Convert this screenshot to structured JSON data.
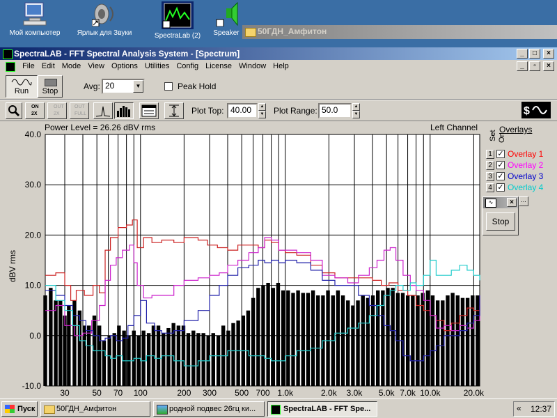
{
  "desktop": {
    "icons": [
      {
        "label": "Мой компьютер",
        "icon": "my-computer-icon"
      },
      {
        "label": "Ярлык для Звуки",
        "icon": "speaker-shortcut-icon"
      },
      {
        "label": "SpectraLab (2)",
        "icon": "spectralab-shortcut-icon"
      },
      {
        "label": "Speaker",
        "icon": "speaker-shortcut-icon"
      }
    ]
  },
  "background_window": {
    "title": "50ГДН_Амфитон"
  },
  "app": {
    "title": "SpectraLAB - FFT Spectral Analysis System - [Spectrum]",
    "menu": [
      "File",
      "Edit",
      "Mode",
      "View",
      "Options",
      "Utilities",
      "Config",
      "License",
      "Window",
      "Help"
    ],
    "run_label": "Run",
    "stop_label": "Stop",
    "avg_label": "Avg:",
    "avg_value": "20",
    "peak_hold_label": "Peak Hold",
    "peak_hold_checked": false,
    "plot_top_label": "Plot Top:",
    "plot_top_value": "40.00",
    "plot_range_label": "Plot Range:",
    "plot_range_value": "50.0",
    "zoom_buttons": [
      "ON 2X",
      "OUT 2X",
      "OUT FULL"
    ],
    "power_level": "Power Level = 26.26 dBV rms",
    "channel": "Left Channel"
  },
  "overlays": {
    "title": "Overlays",
    "set_label": "Set",
    "on_label": "On",
    "items": [
      {
        "num": "1",
        "name": "Overlay 1",
        "color": "#ff0000",
        "on": true
      },
      {
        "num": "2",
        "name": "Overlay 2",
        "color": "#ff00ff",
        "on": true
      },
      {
        "num": "3",
        "name": "Overlay 3",
        "color": "#0000cc",
        "on": true
      },
      {
        "num": "4",
        "name": "Overlay 4",
        "color": "#00cccc",
        "on": true
      }
    ],
    "mini_stop_label": "Stop"
  },
  "taskbar": {
    "start_label": "Пуск",
    "tasks": [
      "50ГДН_Амфитон",
      "родной подвес 26гц ки...",
      "SpectraLAB - FFT Spe..."
    ],
    "clock": "12:37",
    "tray_arrow": "«"
  },
  "chart_data": {
    "type": "bar",
    "ylabel": "dBV rms",
    "xscale": "log",
    "ylim": [
      -10,
      40
    ],
    "xlim": [
      22,
      22000
    ],
    "yticks": [
      "40.0",
      "30.0",
      "20.0",
      "10.0",
      "0.0",
      "-10.0"
    ],
    "ytick_values": [
      40,
      30,
      20,
      10,
      0,
      -10
    ],
    "xticks": [
      "30",
      "50",
      "70",
      "100",
      "200",
      "300",
      "500",
      "700",
      "1.0k",
      "2.0k",
      "3.0k",
      "5.0k",
      "7.0k",
      "10.0k",
      "20.0k"
    ],
    "xtick_values": [
      30,
      50,
      70,
      100,
      200,
      300,
      500,
      700,
      1000,
      2000,
      3000,
      5000,
      7000,
      10000,
      20000
    ],
    "grid": true,
    "bar_freqs": [
      22,
      24,
      26,
      28,
      30,
      32,
      35,
      38,
      41,
      44,
      48,
      52,
      56,
      61,
      66,
      71,
      77,
      83,
      90,
      97,
      105,
      114,
      123,
      133,
      144,
      156,
      169,
      183,
      198,
      214,
      232,
      251,
      272,
      294,
      318,
      345,
      373,
      404,
      437,
      473,
      512,
      554,
      600,
      650,
      703,
      761,
      824,
      892,
      966,
      1046,
      1132,
      1225,
      1326,
      1436,
      1554,
      1682,
      1821,
      1971,
      2134,
      2310,
      2501,
      2707,
      2930,
      3172,
      3434,
      3717,
      4024,
      4356,
      4715,
      5104,
      5525,
      5981,
      6475,
      7009,
      7587,
      8213,
      8891,
      9624,
      10418,
      11278,
      12209,
      13216,
      14306,
      15487,
      16765,
      18148,
      19645,
      21266
    ],
    "bar_values": [
      8,
      9.5,
      7,
      7,
      4,
      6,
      7,
      5,
      2,
      2,
      4,
      2,
      -1,
      0,
      0.5,
      2,
      1,
      0,
      1,
      0,
      1,
      0.5,
      2,
      2,
      0.5,
      1.5,
      2.5,
      2,
      2,
      0.5,
      1,
      0.5,
      0.5,
      0,
      0.5,
      0,
      2,
      1,
      2.5,
      3,
      4,
      5,
      7.5,
      9.5,
      10,
      10.5,
      9.5,
      10.5,
      9,
      9,
      8.5,
      9,
      8.5,
      8.5,
      9,
      8,
      8,
      9,
      8,
      9,
      8,
      7,
      6,
      7,
      8,
      7.5,
      8,
      9,
      9,
      9.5,
      9.5,
      8.5,
      8.5,
      8,
      8,
      8,
      8.5,
      9,
      8,
      7,
      7,
      8,
      8.5,
      8,
      7.5,
      7.5,
      8,
      8
    ],
    "series": [
      {
        "name": "Overlay 1",
        "color": "#cc2222",
        "points": [
          [
            22,
            12
          ],
          [
            26,
            12.5
          ],
          [
            30,
            10
          ],
          [
            33,
            7
          ],
          [
            36,
            9
          ],
          [
            41,
            8
          ],
          [
            47,
            10
          ],
          [
            52,
            8.5
          ],
          [
            57,
            17
          ],
          [
            62,
            19.5
          ],
          [
            70,
            21.5
          ],
          [
            80,
            22
          ],
          [
            88,
            23
          ],
          [
            95,
            17.5
          ],
          [
            105,
            19.5
          ],
          [
            120,
            18.5
          ],
          [
            140,
            19
          ],
          [
            170,
            18.5
          ],
          [
            200,
            19.5
          ],
          [
            250,
            19
          ],
          [
            290,
            18
          ],
          [
            340,
            17.5
          ],
          [
            400,
            17
          ],
          [
            470,
            18
          ],
          [
            560,
            18
          ],
          [
            650,
            17.5
          ],
          [
            720,
            19
          ],
          [
            800,
            18.5
          ],
          [
            900,
            17
          ],
          [
            1000,
            16.5
          ],
          [
            1200,
            16
          ],
          [
            1500,
            14
          ],
          [
            1800,
            12.5
          ],
          [
            2200,
            11.5
          ],
          [
            2700,
            11.5
          ],
          [
            3200,
            11.5
          ],
          [
            4000,
            11
          ],
          [
            4600,
            10
          ],
          [
            5200,
            10.5
          ],
          [
            6000,
            9
          ],
          [
            7000,
            8
          ],
          [
            8000,
            6
          ],
          [
            9000,
            5
          ],
          [
            10000,
            4
          ],
          [
            11000,
            3
          ],
          [
            12500,
            1
          ],
          [
            14000,
            2.5
          ],
          [
            16000,
            4
          ],
          [
            18000,
            5.5
          ],
          [
            20000,
            5
          ],
          [
            22000,
            8
          ]
        ]
      },
      {
        "name": "Overlay 2",
        "color": "#cc22cc",
        "points": [
          [
            22,
            5
          ],
          [
            26,
            6
          ],
          [
            30,
            2
          ],
          [
            35,
            0
          ],
          [
            40,
            0.5
          ],
          [
            46,
            3
          ],
          [
            52,
            6
          ],
          [
            57,
            11
          ],
          [
            62,
            14
          ],
          [
            68,
            15.5
          ],
          [
            75,
            17
          ],
          [
            84,
            18
          ],
          [
            90,
            14.5
          ],
          [
            95,
            10
          ],
          [
            105,
            7.5
          ],
          [
            120,
            8
          ],
          [
            140,
            8
          ],
          [
            170,
            10
          ],
          [
            200,
            11
          ],
          [
            250,
            11.5
          ],
          [
            300,
            12
          ],
          [
            350,
            12.5
          ],
          [
            400,
            14
          ],
          [
            470,
            15
          ],
          [
            560,
            16.5
          ],
          [
            650,
            17.5
          ],
          [
            720,
            19.5
          ],
          [
            800,
            19
          ],
          [
            900,
            17
          ],
          [
            1000,
            17
          ],
          [
            1200,
            16.5
          ],
          [
            1500,
            15
          ],
          [
            1800,
            12
          ],
          [
            2200,
            11.5
          ],
          [
            2700,
            10.5
          ],
          [
            3200,
            12
          ],
          [
            3800,
            13.5
          ],
          [
            4300,
            15
          ],
          [
            4800,
            17
          ],
          [
            5300,
            17.5
          ],
          [
            5800,
            15
          ],
          [
            6500,
            12
          ],
          [
            7300,
            10
          ],
          [
            8000,
            9
          ],
          [
            9000,
            7
          ],
          [
            10000,
            4
          ],
          [
            11000,
            1.5
          ],
          [
            12500,
            2
          ],
          [
            14000,
            1
          ],
          [
            16000,
            2
          ],
          [
            18000,
            1.5
          ],
          [
            20000,
            3
          ],
          [
            22000,
            6
          ]
        ]
      },
      {
        "name": "Overlay 3",
        "color": "#2222aa",
        "points": [
          [
            22,
            9
          ],
          [
            26,
            8
          ],
          [
            30,
            6
          ],
          [
            34,
            4
          ],
          [
            38,
            3
          ],
          [
            42,
            1
          ],
          [
            47,
            0
          ],
          [
            52,
            -1
          ],
          [
            57,
            -0.5
          ],
          [
            62,
            0
          ],
          [
            68,
            -1
          ],
          [
            75,
            -0.5
          ],
          [
            82,
            2
          ],
          [
            90,
            4
          ],
          [
            100,
            7
          ],
          [
            110,
            2.5
          ],
          [
            125,
            1
          ],
          [
            140,
            0.5
          ],
          [
            170,
            1
          ],
          [
            200,
            3
          ],
          [
            250,
            5
          ],
          [
            300,
            8
          ],
          [
            350,
            10
          ],
          [
            400,
            12
          ],
          [
            470,
            13.5
          ],
          [
            560,
            14
          ],
          [
            650,
            15
          ],
          [
            720,
            14.5
          ],
          [
            800,
            15
          ],
          [
            900,
            14.5
          ],
          [
            1000,
            15
          ],
          [
            1200,
            14.5
          ],
          [
            1500,
            13
          ],
          [
            1800,
            11
          ],
          [
            2200,
            10
          ],
          [
            2700,
            10
          ],
          [
            3200,
            8
          ],
          [
            3800,
            6
          ],
          [
            4300,
            4
          ],
          [
            4800,
            2
          ],
          [
            5300,
            1
          ],
          [
            5800,
            -1
          ],
          [
            6500,
            -4
          ],
          [
            7300,
            -5
          ],
          [
            8000,
            -5
          ],
          [
            9000,
            -4
          ],
          [
            10000,
            -3
          ],
          [
            11000,
            -2
          ],
          [
            12500,
            0
          ],
          [
            14000,
            0
          ],
          [
            16000,
            1
          ],
          [
            18000,
            2.5
          ],
          [
            20000,
            4
          ],
          [
            22000,
            8
          ]
        ]
      },
      {
        "name": "Overlay 4",
        "color": "#22cccc",
        "points": [
          [
            22,
            10
          ],
          [
            26,
            7
          ],
          [
            30,
            5
          ],
          [
            34,
            2
          ],
          [
            38,
            -1
          ],
          [
            42,
            -2
          ],
          [
            47,
            -3
          ],
          [
            52,
            -3
          ],
          [
            57,
            -4
          ],
          [
            62,
            -4.5
          ],
          [
            68,
            -4
          ],
          [
            75,
            -5
          ],
          [
            82,
            -5
          ],
          [
            90,
            -4.5
          ],
          [
            100,
            -5
          ],
          [
            110,
            -4
          ],
          [
            125,
            -4.5
          ],
          [
            140,
            -4
          ],
          [
            170,
            -5
          ],
          [
            200,
            -6
          ],
          [
            250,
            -5
          ],
          [
            300,
            -4
          ],
          [
            350,
            -4
          ],
          [
            400,
            -3
          ],
          [
            470,
            -3
          ],
          [
            560,
            -4
          ],
          [
            650,
            -4
          ],
          [
            720,
            -4.5
          ],
          [
            800,
            -5
          ],
          [
            900,
            -5
          ],
          [
            1000,
            -4
          ],
          [
            1200,
            -3
          ],
          [
            1500,
            -2.5
          ],
          [
            1800,
            -1
          ],
          [
            2200,
            0.5
          ],
          [
            2700,
            1.5
          ],
          [
            3200,
            2.5
          ],
          [
            3800,
            4
          ],
          [
            4300,
            6
          ],
          [
            4800,
            8
          ],
          [
            5300,
            9
          ],
          [
            5800,
            10
          ],
          [
            6500,
            9
          ],
          [
            7300,
            10.5
          ],
          [
            8000,
            10
          ],
          [
            9000,
            12
          ],
          [
            10000,
            15
          ],
          [
            11000,
            12
          ],
          [
            12500,
            12
          ],
          [
            14000,
            13
          ],
          [
            16000,
            14
          ],
          [
            18000,
            13
          ],
          [
            20000,
            12
          ],
          [
            22000,
            11
          ]
        ]
      }
    ]
  }
}
